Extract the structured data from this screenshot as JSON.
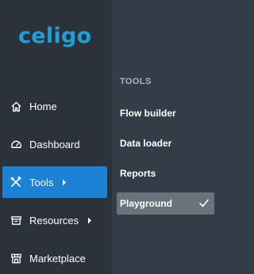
{
  "brand": {
    "logo_text": "celigo",
    "accent_color": "#1d9fd9"
  },
  "nav": {
    "items": [
      {
        "label": "Home",
        "icon": "home-icon"
      },
      {
        "label": "Dashboard",
        "icon": "dashboard-gauge-icon"
      },
      {
        "label": "Tools",
        "icon": "tools-icon",
        "active": true,
        "has_submenu": true
      },
      {
        "label": "Resources",
        "icon": "resources-icon",
        "has_submenu": true
      },
      {
        "label": "Marketplace",
        "icon": "marketplace-icon"
      }
    ],
    "active_color": "#1c82d6"
  },
  "flyout": {
    "heading": "TOOLS",
    "items": [
      {
        "label": "Flow builder"
      },
      {
        "label": "Data loader"
      },
      {
        "label": "Reports"
      },
      {
        "label": "Playground",
        "selected": true
      }
    ]
  }
}
